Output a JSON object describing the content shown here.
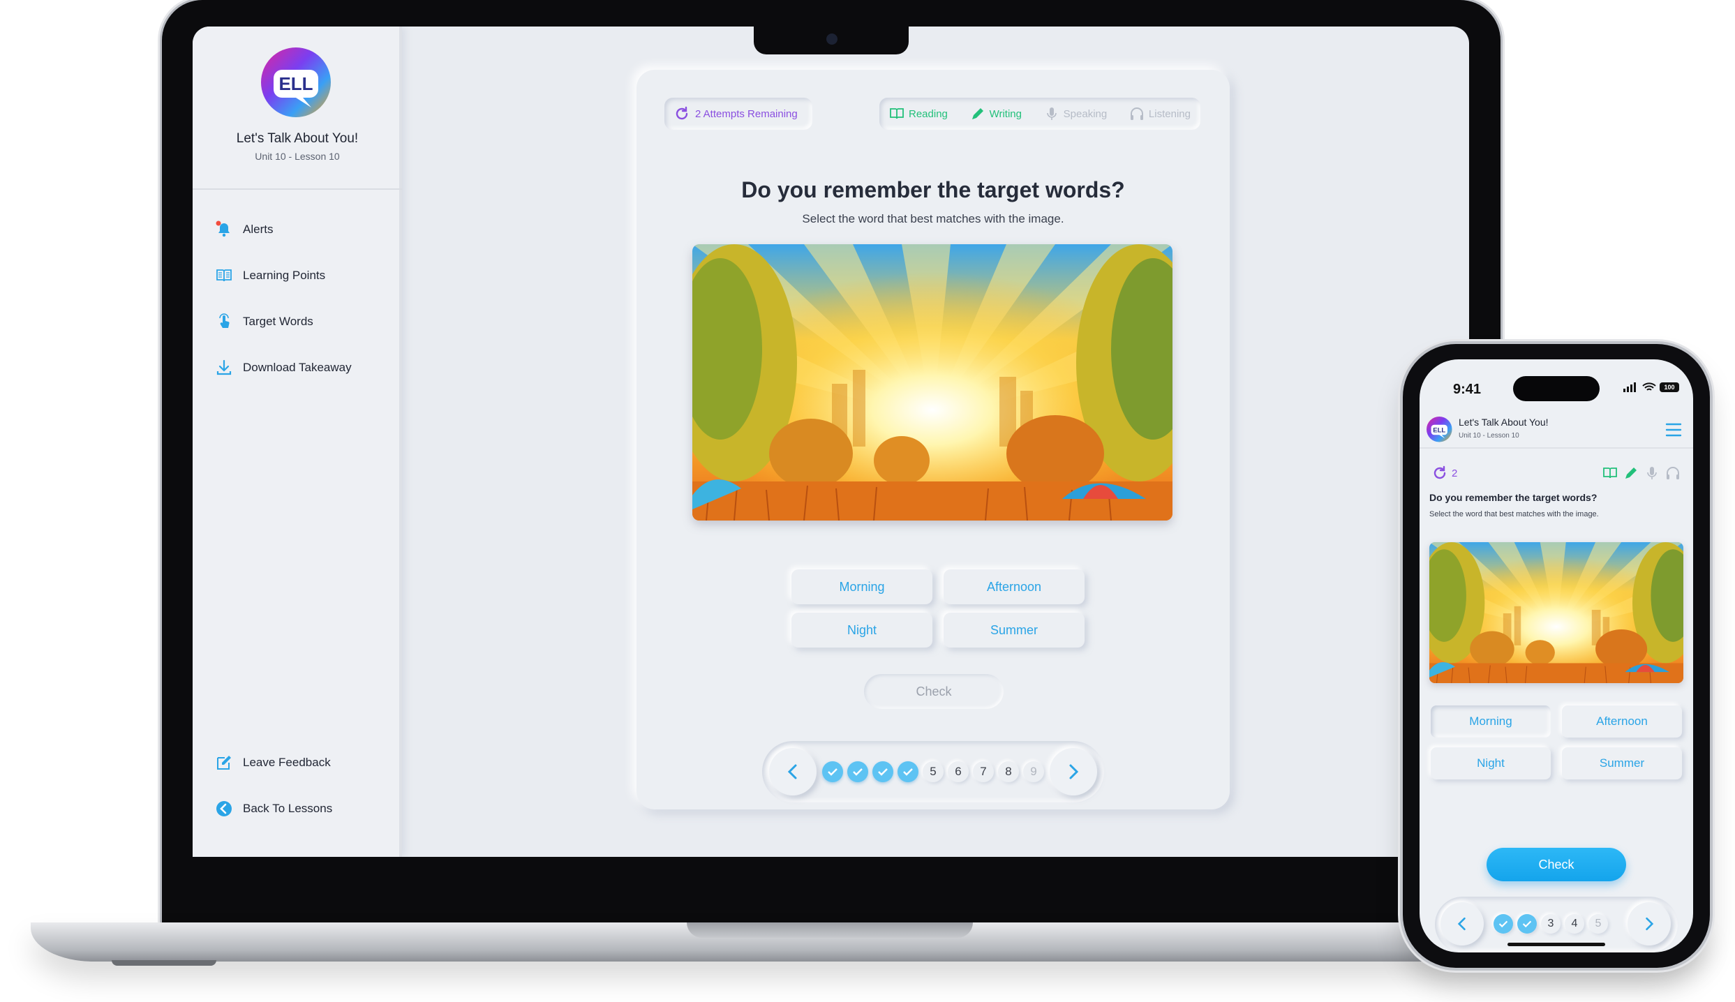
{
  "lesson": {
    "title": "Let's Talk About You!",
    "subtitle": "Unit 10 - Lesson 10",
    "logo_text": "ELL"
  },
  "sidebar": {
    "items": [
      {
        "label": "Alerts",
        "icon": "bell-icon"
      },
      {
        "label": "Learning Points",
        "icon": "book-icon"
      },
      {
        "label": "Target Words",
        "icon": "tap-icon"
      },
      {
        "label": "Download Takeaway",
        "icon": "download-icon"
      }
    ],
    "footer_items": [
      {
        "label": "Leave Feedback",
        "icon": "edit-icon"
      },
      {
        "label": "Back To Lessons",
        "icon": "back-icon"
      }
    ]
  },
  "exercise": {
    "attempts_label": "2 Attempts Remaining",
    "attempts_short": "2",
    "skills": [
      "Reading",
      "Writing",
      "Speaking",
      "Listening"
    ],
    "question": "Do you remember the target words?",
    "instruction": "Select the word that best matches with the image.",
    "options": [
      "Morning",
      "Afternoon",
      "Night",
      "Summer"
    ],
    "check_label": "Check"
  },
  "pager": {
    "pages": [
      "5",
      "6",
      "7",
      "8",
      "9"
    ]
  },
  "phone": {
    "time": "9:41",
    "battery": "100",
    "pages": [
      "3",
      "4",
      "5"
    ]
  },
  "colors": {
    "accent": "#2aa4e6",
    "attempts": "#8a4fe0",
    "active_skill": "#22c07a",
    "inactive_skill": "#b6bcc7",
    "check_active": "#14a4ec"
  }
}
